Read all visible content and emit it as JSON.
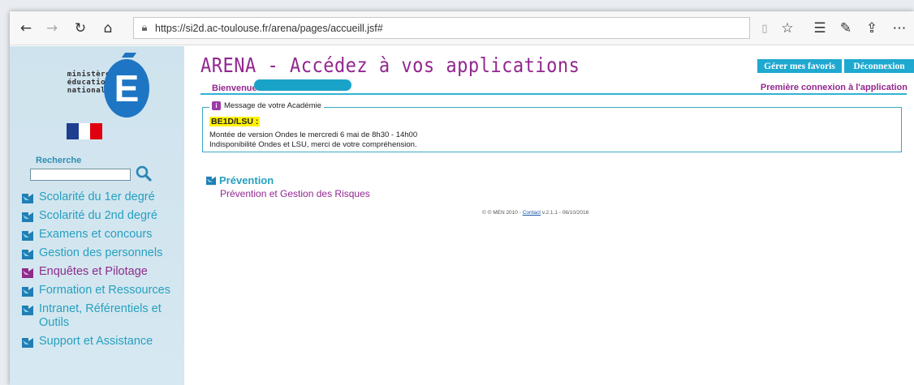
{
  "browser": {
    "url": "https://si2d.ac-toulouse.fr/arena/pages/accueill.jsf#",
    "icons": [
      "back-icon",
      "forward-icon",
      "refresh-icon",
      "home-icon",
      "lock-icon",
      "reading-view-icon",
      "favorite-star-icon",
      "favorites-list-icon",
      "pen-icon",
      "share-icon",
      "more-icon"
    ]
  },
  "sidebar": {
    "logo": {
      "line1": "ministère",
      "line2": "éducation",
      "line3": "nationale",
      "letter": "E"
    },
    "search_label": "Recherche",
    "search_value": "",
    "menu": [
      {
        "label": "Scolarité du 1er degré"
      },
      {
        "label": "Scolarité du 2nd degré"
      },
      {
        "label": "Examens et concours"
      },
      {
        "label": "Gestion des personnels"
      },
      {
        "label": "Enquêtes et Pilotage"
      },
      {
        "label": "Formation et Ressources"
      },
      {
        "label": "Intranet, Référentiels et Outils"
      },
      {
        "label": "Support et Assistance"
      }
    ]
  },
  "header": {
    "title": "ARENA - Accédez à vos applications",
    "welcome": "Bienvenue",
    "btn_favorites": "Gérer mes favoris",
    "btn_logout": "Déconnexion",
    "first_connection": "Première connexion à l'application"
  },
  "message": {
    "legend": "Message de votre Académie",
    "highlight": "BE1D/LSU :",
    "line1": "Montée de version Ondes le mercredi 6 mai de 8h30 - 14h00",
    "line2": "Indisponibilité Ondes et LSU, merci de votre compréhension."
  },
  "prevention": {
    "title": "Prévention",
    "link": "Prévention et Gestion des Risques"
  },
  "footer": {
    "prefix": "© © MEN 2010 - ",
    "contact": "Contact",
    "suffix": " v.2.1.1 - 06/10/2016"
  },
  "colors": {
    "purple": "#92278f",
    "teal": "#26a0bf",
    "button_blue": "#1fa9d0",
    "sidebar_bg": "#d0e4ee"
  }
}
